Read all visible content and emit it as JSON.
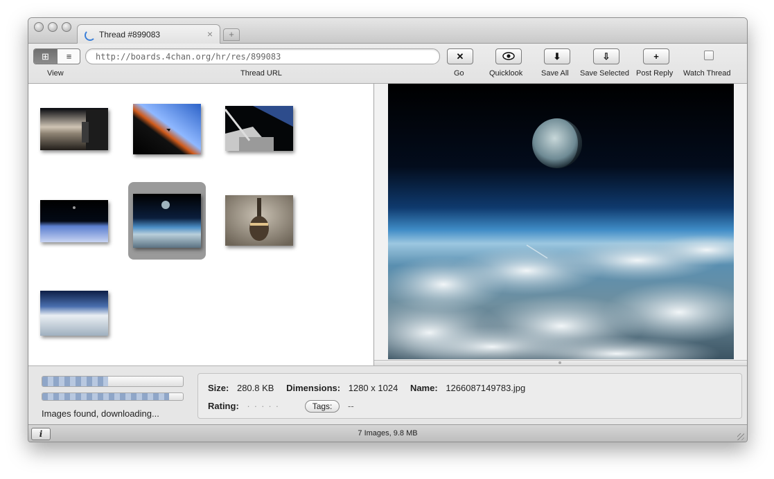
{
  "tab": {
    "title": "Thread #899083",
    "close_glyph": "×",
    "new_tab_glyph": "+"
  },
  "toolbar": {
    "view_label": "View",
    "view_modes": [
      {
        "icon": "grid-view-icon",
        "glyph": "⊞",
        "active": true
      },
      {
        "icon": "list-view-icon",
        "glyph": "≡",
        "active": false
      }
    ],
    "url_label": "Thread URL",
    "url_value": "http://boards.4chan.org/hr/res/899083",
    "buttons": [
      {
        "id": "go",
        "label": "Go",
        "icon": "close-icon",
        "glyph": "✕"
      },
      {
        "id": "quicklook",
        "label": "Quicklook",
        "icon": "eye-icon",
        "glyph": "👁"
      },
      {
        "id": "save-all",
        "label": "Save All",
        "icon": "download-icon",
        "glyph": "⬇"
      },
      {
        "id": "save-selected",
        "label": "Save Selected",
        "icon": "download-outline-icon",
        "glyph": "⇩"
      },
      {
        "id": "post-reply",
        "label": "Post Reply",
        "icon": "plus-icon",
        "glyph": "+"
      }
    ],
    "watch_label": "Watch Thread",
    "watch_checked": false
  },
  "thumbnails": [
    {
      "scene": "station-earth-limb",
      "selected": false
    },
    {
      "scene": "shuttle-orange-limb",
      "selected": false
    },
    {
      "scene": "shuttle-cargo-bay",
      "selected": false
    },
    {
      "scene": "moon-over-earth",
      "selected": false
    },
    {
      "scene": "planet-over-clouds",
      "selected": true
    },
    {
      "scene": "tower-upward",
      "selected": false
    },
    {
      "scene": "clouds-horizon",
      "selected": false
    }
  ],
  "progress": {
    "primary": 0.47,
    "secondary": 0.9
  },
  "status_text": "Images found, downloading...",
  "info": {
    "size_label": "Size:",
    "size_value": "280.8 KB",
    "dimensions_label": "Dimensions:",
    "dimensions_value": "1280 x 1024",
    "name_label": "Name:",
    "name_value": "1266087149783.jpg",
    "rating_label": "Rating:",
    "rating_value": 0,
    "rating_max": 5,
    "tags_button": "Tags:",
    "tags_value": "--"
  },
  "statusbar": {
    "info_button": "i",
    "summary": "7 Images, 9.8 MB"
  },
  "colors": {
    "accent": "#3a7fd8",
    "selection": "#9a9a9a"
  }
}
